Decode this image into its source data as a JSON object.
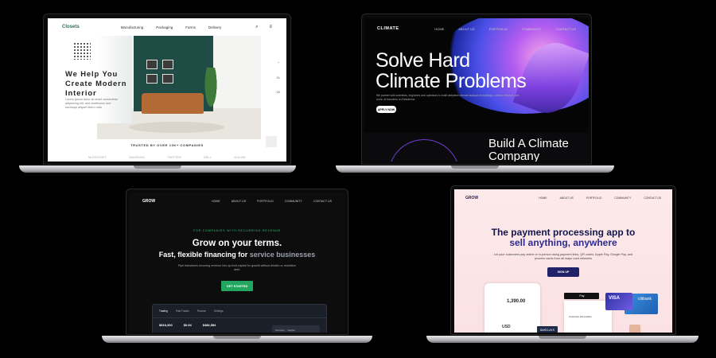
{
  "closets": {
    "logo": "Closets",
    "nav": [
      "Manufacturing",
      "Packaging",
      "Farms",
      "Delivery"
    ],
    "headline": "We Help You Create Modern Interior",
    "sub": "Lorem ipsum dolor sit amet consectetur adipiscing elit, sed vestibulum sed sociosqu aliquet libero odio",
    "side": [
      "01",
      "02",
      "03"
    ],
    "trusted": "TRUSTED BY OVER 10K+ COMPANIES",
    "logos": [
      "MCROSOFT",
      "SAMSUNG",
      "TWITTER",
      "DELL",
      "GOLINE"
    ],
    "icons": [
      "search-icon",
      "menu-icon"
    ]
  },
  "climate": {
    "logo": "CLIMATE",
    "nav": [
      "HOME",
      "ABOUT US",
      "PORTFOLIO",
      "COMMUNITY",
      "CONTACT US"
    ],
    "headline_1": "Solve Hard",
    "headline_2": "Climate Problems",
    "sub": "We partner with scientists, engineers and operators to build deeptech climate startups in buildings, carbon removal, and more. At founders on Residence.",
    "cta": "APPLY NOW",
    "section_1": "Build A Climate",
    "section_2": "Company"
  },
  "grow_dark": {
    "logo": "GROW",
    "nav": [
      "HOME",
      "ABOUT US",
      "PORTFOLIO",
      "COMMUNITY",
      "CONTACT US"
    ],
    "eyebrow": "FOR COMPANIES WITH RECURRING REVENUE",
    "headline": "Grow on your terms.",
    "sub_1": "Fast, flexible financing for ",
    "sub_2": "service businesses",
    "body": "Pipe transforms recurring revenue into up-front capital for growth without dilution or restrictive debt.",
    "cta": "GET STARTED",
    "tabs": [
      "Trading",
      "Past Trades",
      "Finance",
      "Settings"
    ],
    "values": [
      "$818,300",
      "$0.94",
      "$486,584"
    ],
    "card_labels": [
      "Summary",
      "Insights"
    ]
  },
  "grow_pink": {
    "logo": "GROW",
    "nav": [
      "HOME",
      "ABOUT US",
      "PORTFOLIO",
      "COMMUNITY",
      "CONTACT US"
    ],
    "headline_1": "The payment processing app to",
    "headline_2": "sell anything, anywhere",
    "sub": "Let your customers pay online or in-person using payment links, QR codes, Apple Pay, Google Pay, and process cards from all major card networks",
    "cta": "SIGN UP",
    "amount": "1,390.00",
    "usd": "USD",
    "apple_pay": "Pay",
    "customer_info": "Customer Information",
    "visa": "VISA",
    "citi": "citibank",
    "bank_tag": "BARCLAYS"
  }
}
